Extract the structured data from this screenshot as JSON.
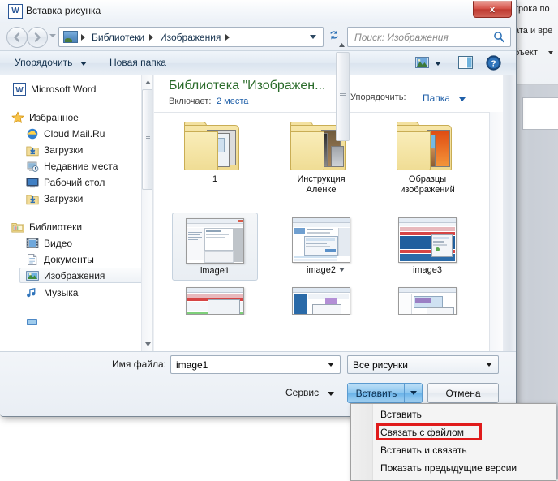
{
  "background": {
    "ribbon_items": [
      "трока по",
      "ата и вре",
      "бъект"
    ]
  },
  "dialog": {
    "title": "Вставка рисунка",
    "title_icon": "word-icon",
    "title_icon_letter": "W",
    "close_label": "x",
    "navigation": {
      "back_icon": "back-arrow-icon",
      "forward_icon": "forward-arrow-icon",
      "history_icon": "history-dropdown-icon",
      "address_icon": "pictures-library-icon",
      "breadcrumbs": [
        "Библиотеки",
        "Изображения"
      ],
      "refresh_icon": "refresh-icon",
      "search_placeholder": "Поиск: Изображения",
      "search_icon": "search-icon"
    },
    "commandbar": {
      "organize": "Упорядочить",
      "new_folder": "Новая папка",
      "view_icon": "view-mode-icon",
      "preview_pane_icon": "preview-pane-icon",
      "help_icon": "help-icon"
    },
    "navpane": {
      "items": [
        {
          "label": "Microsoft Word",
          "icon": "word-icon",
          "level": "root",
          "selected": false
        },
        {
          "label": "Избранное",
          "icon": "star-icon",
          "level": "group",
          "selected": false
        },
        {
          "label": "Cloud Mail.Ru",
          "icon": "cloud-icon",
          "level": "child",
          "selected": false
        },
        {
          "label": "Загрузки",
          "icon": "downloads-icon",
          "level": "child",
          "selected": false
        },
        {
          "label": "Недавние места",
          "icon": "recent-places-icon",
          "level": "child",
          "selected": false
        },
        {
          "label": "Рабочий стол",
          "icon": "desktop-icon",
          "level": "child",
          "selected": false
        },
        {
          "label": "Загрузки",
          "icon": "downloads-icon",
          "level": "child",
          "selected": false
        },
        {
          "label": "Библиотеки",
          "icon": "libraries-icon",
          "level": "group",
          "selected": false
        },
        {
          "label": "Видео",
          "icon": "video-library-icon",
          "level": "child",
          "selected": false
        },
        {
          "label": "Документы",
          "icon": "documents-library-icon",
          "level": "child",
          "selected": false
        },
        {
          "label": "Изображения",
          "icon": "pictures-library-icon",
          "level": "child",
          "selected": true
        },
        {
          "label": "Музыка",
          "icon": "music-library-icon",
          "level": "child",
          "selected": false
        }
      ]
    },
    "filepane": {
      "library_title": "Библиотека \"Изображен...",
      "includes_label": "Включает:",
      "includes_value": "2 места",
      "arrange_label": "Упорядочить:",
      "arrange_value": "Папка",
      "items": [
        {
          "name": "1",
          "type": "folder",
          "selected": false
        },
        {
          "name": "Инструкция\nАленке",
          "type": "folder",
          "selected": false
        },
        {
          "name": "Образцы\nизображений",
          "type": "folder",
          "selected": false
        },
        {
          "name": "image1",
          "type": "image",
          "selected": true
        },
        {
          "name": "image2",
          "type": "image",
          "selected": false
        },
        {
          "name": "image3",
          "type": "image",
          "selected": false
        }
      ]
    },
    "footer": {
      "filename_label": "Имя файла:",
      "filename_value": "image1",
      "filetype_value": "Все рисунки",
      "service_label": "Сервис",
      "insert_label": "Вставить",
      "cancel_label": "Отмена"
    },
    "context_menu": {
      "items": [
        {
          "label": "Вставить",
          "highlighted": false
        },
        {
          "label": "Связать с файлом",
          "highlighted": true
        },
        {
          "label": "Вставить и связать",
          "highlighted": false
        },
        {
          "label": "Показать предыдущие версии",
          "highlighted": false
        }
      ],
      "highlight_color": "#e01b1b"
    }
  }
}
